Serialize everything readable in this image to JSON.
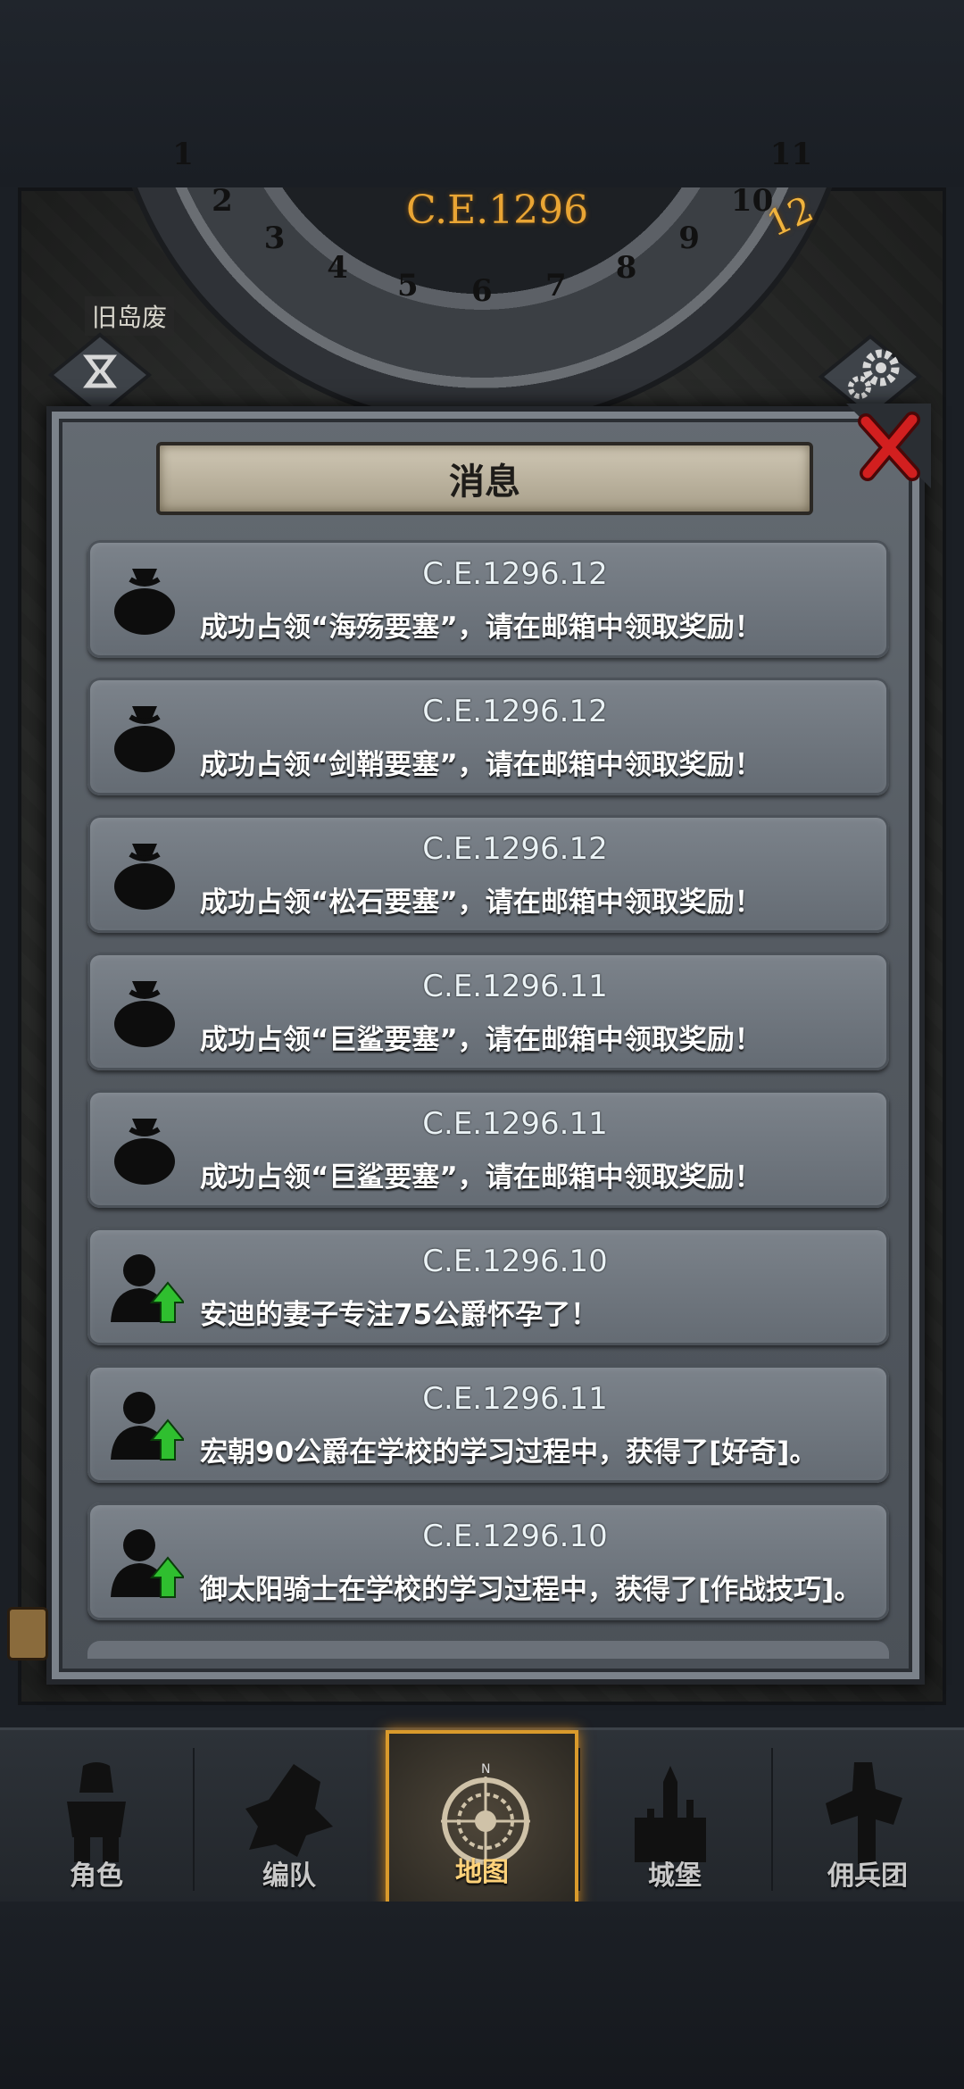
{
  "calendar": {
    "year": "C.E.1296",
    "month": "12",
    "ring_numbers": [
      "1",
      "2",
      "3",
      "4",
      "5",
      "6",
      "7",
      "8",
      "9",
      "10",
      "11"
    ]
  },
  "map": {
    "place_label": "旧岛废"
  },
  "panel": {
    "title": "消息"
  },
  "messages": [
    {
      "date": "C.E.1296.12",
      "text": "成功占领“海殇要塞”，请在邮箱中领取奖励！",
      "icon": "money-bag-icon"
    },
    {
      "date": "C.E.1296.12",
      "text": "成功占领“剑鞘要塞”，请在邮箱中领取奖励！",
      "icon": "money-bag-icon"
    },
    {
      "date": "C.E.1296.12",
      "text": "成功占领“松石要塞”，请在邮箱中领取奖励！",
      "icon": "money-bag-icon"
    },
    {
      "date": "C.E.1296.11",
      "text": "成功占领“巨鲨要塞”，请在邮箱中领取奖励！",
      "icon": "money-bag-icon"
    },
    {
      "date": "C.E.1296.11",
      "text": "成功占领“巨鲨要塞”，请在邮箱中领取奖励！",
      "icon": "money-bag-icon"
    },
    {
      "date": "C.E.1296.10",
      "text": "安迪的妻子专注75公爵怀孕了！",
      "icon": "person-up-icon"
    },
    {
      "date": "C.E.1296.11",
      "text": "宏朝90公爵在学校的学习过程中，获得了[好奇]。",
      "icon": "person-up-icon"
    },
    {
      "date": "C.E.1296.10",
      "text": "御太阳骑士在学校的学习过程中，获得了[作战技巧]。",
      "icon": "person-up-icon"
    }
  ],
  "nav": [
    {
      "label": "角色",
      "icon": "knight-icon",
      "active": false
    },
    {
      "label": "编队",
      "icon": "squad-icon",
      "active": false
    },
    {
      "label": "地图",
      "icon": "compass-icon",
      "active": true
    },
    {
      "label": "城堡",
      "icon": "castle-icon",
      "active": false
    },
    {
      "label": "佣兵团",
      "icon": "mercenary-icon",
      "active": false
    }
  ],
  "colors": {
    "accent": "#d99a2c",
    "year": "#e9a534",
    "close": "#d21f1f",
    "arrow": "#2fbf2f"
  }
}
